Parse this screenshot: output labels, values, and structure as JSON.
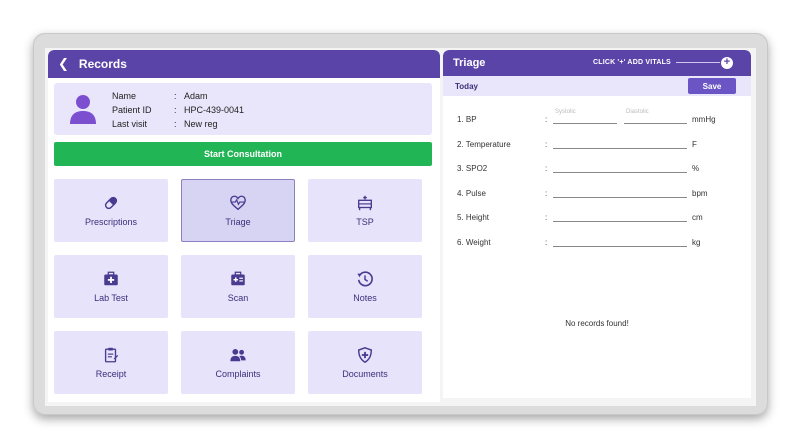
{
  "records": {
    "title": "Records",
    "patient": {
      "name_label": "Name",
      "name_value": "Adam",
      "id_label": "Patient ID",
      "id_value": "HPC-439-0041",
      "visit_label": "Last visit",
      "visit_value": "New reg",
      "colon": ":"
    },
    "start_consultation": "Start Consultation",
    "tiles": [
      {
        "label": "Prescriptions",
        "icon": "pill-icon"
      },
      {
        "label": "Triage",
        "icon": "heartbeat-icon"
      },
      {
        "label": "TSP",
        "icon": "bed-icon"
      },
      {
        "label": "Lab Test",
        "icon": "medical-kit-icon"
      },
      {
        "label": "Scan",
        "icon": "scan-icon"
      },
      {
        "label": "Notes",
        "icon": "history-icon"
      },
      {
        "label": "Receipt",
        "icon": "receipt-icon"
      },
      {
        "label": "Complaints",
        "icon": "users-icon"
      },
      {
        "label": "Documents",
        "icon": "shield-plus-icon"
      }
    ],
    "active_tile": "Triage"
  },
  "triage": {
    "title": "Triage",
    "hint": "CLICK '+' ADD VITALS",
    "plus": "+",
    "today": "Today",
    "save": "Save",
    "systolic_placeholder": "Systolic",
    "diastolic_placeholder": "Diastolic",
    "vitals": [
      {
        "label": "1. BP",
        "unit": "mmHg"
      },
      {
        "label": "2. Temperature",
        "unit": "F"
      },
      {
        "label": "3. SPO2",
        "unit": "%"
      },
      {
        "label": "4. Pulse",
        "unit": "bpm"
      },
      {
        "label": "5. Height",
        "unit": "cm"
      },
      {
        "label": "6. Weight",
        "unit": "kg"
      }
    ],
    "no_records": "No records found!"
  },
  "colors": {
    "primary": "#5b44a8",
    "tile_bg": "#e6e3fa",
    "start_green": "#22b556"
  }
}
